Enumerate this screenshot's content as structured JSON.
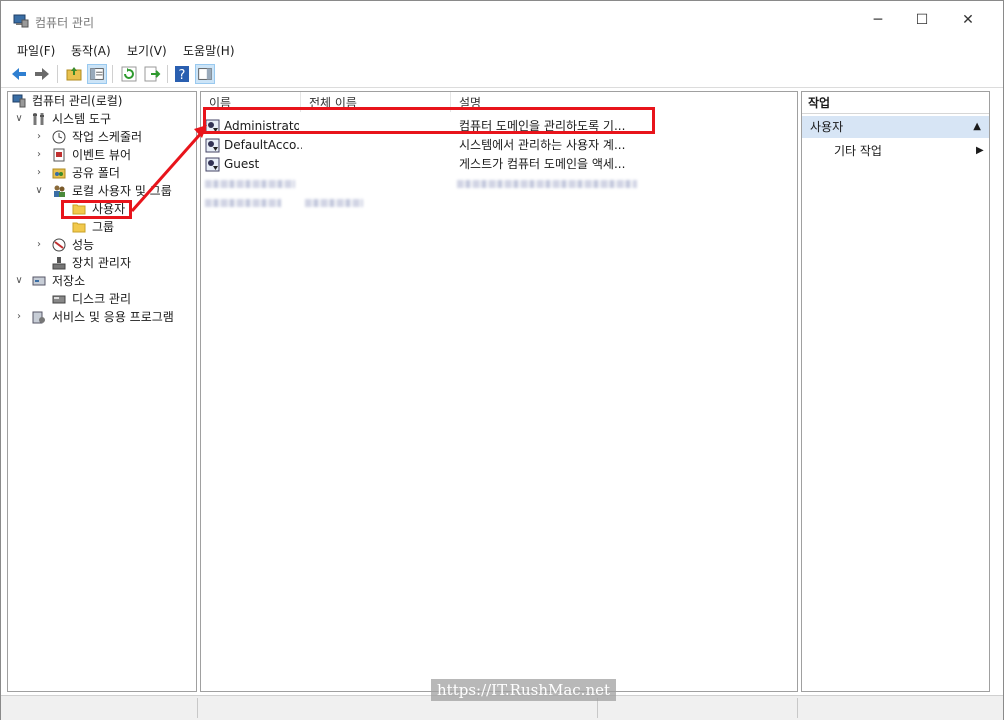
{
  "window": {
    "title": "컴퓨터 관리",
    "minimize": "─",
    "maximize": "☐",
    "close": "✕"
  },
  "menu": [
    "파일(F)",
    "동작(A)",
    "보기(V)",
    "도움말(H)"
  ],
  "tree": {
    "root": "컴퓨터 관리(로컬)",
    "system_tools": "시스템 도구",
    "task_scheduler": "작업 스케줄러",
    "event_viewer": "이벤트 뷰어",
    "shared_folders": "공유 폴더",
    "local_users_groups": "로컬 사용자 및 그룹",
    "users": "사용자",
    "groups": "그룹",
    "performance": "성능",
    "device_manager": "장치 관리자",
    "storage": "저장소",
    "disk_management": "디스크 관리",
    "services_apps": "서비스 및 응용 프로그램"
  },
  "list": {
    "columns": [
      "이름",
      "전체 이름",
      "설명"
    ],
    "rows": [
      {
        "name": "Administrator",
        "full_name": "",
        "description": "컴퓨터 도메인을 관리하도록 기..."
      },
      {
        "name": "DefaultAcco...",
        "full_name": "",
        "description": "시스템에서 관리하는 사용자 계..."
      },
      {
        "name": "Guest",
        "full_name": "",
        "description": "게스트가 컴퓨터 도메인을 액세..."
      }
    ]
  },
  "actions": {
    "header": "작업",
    "section": "사용자",
    "more": "기타 작업"
  },
  "watermark": "https://IT.RushMac.net",
  "colors": {
    "highlight": "#e8141b",
    "section_bg": "#d7e5f5"
  }
}
